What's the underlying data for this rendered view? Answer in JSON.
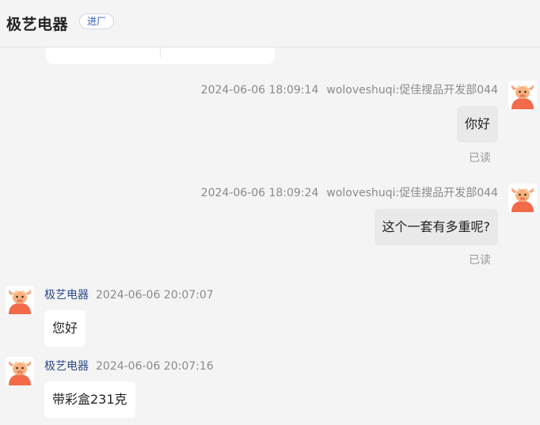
{
  "header": {
    "title": "极艺电器",
    "badge": "进厂"
  },
  "messages": [
    {
      "time": "2024-06-06 18:09:14",
      "sender": "woloveshuqi:促佳搜品开发部044",
      "text": "你好",
      "status": "已读"
    },
    {
      "time": "2024-06-06 18:09:24",
      "sender": "woloveshuqi:促佳搜品开发部044",
      "text": "这个一套有多重呢?",
      "status": "已读"
    },
    {
      "sender": "极艺电器",
      "time": "2024-06-06 20:07:07",
      "text": "您好"
    },
    {
      "sender": "极艺电器",
      "time": "2024-06-06 20:07:16",
      "text": "带彩盒231克"
    }
  ],
  "colors": {
    "background": "#f4f4f4",
    "outgoing_bubble": "#e9e9e9",
    "incoming_bubble": "#ffffff",
    "sender_name": "#2d4a8a",
    "badge_text": "#2d5fb8"
  },
  "icons": {
    "avatar": "cartoon-bull-avatar"
  }
}
